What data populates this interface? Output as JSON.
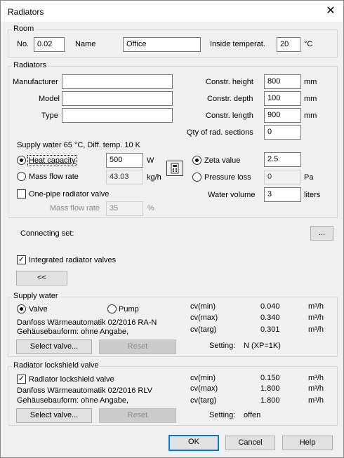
{
  "window": {
    "title": "Radiators",
    "close": "✕"
  },
  "room": {
    "group": "Room",
    "no_label": "No.",
    "no_value": "0.02",
    "name_label": "Name",
    "name_value": "Office",
    "temp_label": "Inside temperat.",
    "temp_value": "20",
    "temp_unit": "°C"
  },
  "radiators": {
    "group": "Radiators",
    "manufacturer_label": "Manufacturer",
    "manufacturer_value": "",
    "model_label": "Model",
    "model_value": "",
    "type_label": "Type",
    "type_value": "",
    "height_label": "Constr. height",
    "height_value": "800",
    "height_unit": "mm",
    "depth_label": "Constr. depth",
    "depth_value": "100",
    "depth_unit": "mm",
    "length_label": "Constr. length",
    "length_value": "900",
    "length_unit": "mm",
    "sections_label": "Qty of rad. sections",
    "sections_value": "0",
    "supply_info": "Supply water 65 °C, Diff. temp. 10 K",
    "heat_label": "Heat capacity",
    "heat_value": "500",
    "heat_unit": "W",
    "massflow_label": "Mass flow rate",
    "massflow_value": "43.03",
    "massflow_unit": "kg/h",
    "zeta_label": "Zeta value",
    "zeta_value": "2.5",
    "ploss_label": "Pressure loss",
    "ploss_value": "0",
    "ploss_unit": "Pa",
    "water_label": "Water volume",
    "water_value": "3",
    "water_unit": "liters",
    "onepipe_label": "One-pipe radiator valve",
    "onepipe_mf_label": "Mass flow rate",
    "onepipe_mf_value": "35",
    "onepipe_mf_unit": "%"
  },
  "connecting": {
    "label": "Connecting set:",
    "button": "..."
  },
  "integrated": {
    "label": "Integrated radiator valves",
    "collapse": "<<"
  },
  "supply": {
    "group": "Supply water",
    "valve_label": "Valve",
    "pump_label": "Pump",
    "line1": "Danfoss Wärmeautomatik 02/2016 RA-N",
    "line2": "Gehäusebauform: ohne Angabe,",
    "cvmin_label": "cv(min)",
    "cvmin_value": "0.040",
    "cvmax_label": "cv(max)",
    "cvmax_value": "0.340",
    "cvtarg_label": "cv(targ)",
    "cvtarg_value": "0.301",
    "unit": "m³/h",
    "select_button": "Select valve...",
    "reset_button": "Reset",
    "setting_label": "Setting:",
    "setting_value": "N (XP=1K)"
  },
  "lockshield": {
    "group": "Radiator lockshield valve",
    "check_label": "Radiator lockshield valve",
    "line1": "Danfoss Wärmeautomatik 02/2016 RLV",
    "line2": "Gehäusebauform: ohne Angabe,",
    "cvmin_label": "cv(min)",
    "cvmin_value": "0.150",
    "cvmax_label": "cv(max)",
    "cvmax_value": "1.800",
    "cvtarg_label": "cv(targ)",
    "cvtarg_value": "1.800",
    "unit": "m³/h",
    "select_button": "Select valve...",
    "reset_button": "Reset",
    "setting_label": "Setting:",
    "setting_value": "offen"
  },
  "footer": {
    "ok": "OK",
    "cancel": "Cancel",
    "help": "Help"
  }
}
